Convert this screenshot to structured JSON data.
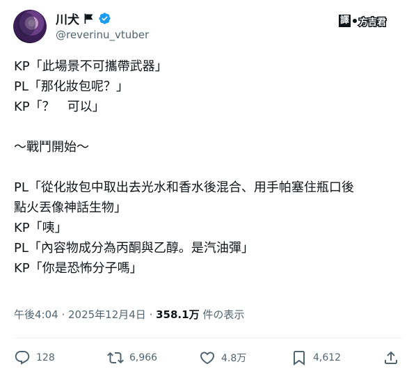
{
  "author": {
    "display_name": "川犬",
    "handle": "@reverinu_vtuber"
  },
  "watermark": {
    "prefix": "譯",
    "name": "方吉君"
  },
  "tweet": {
    "lines": [
      "KP「此場景不可攜帶武器」",
      "PL「那化妝包呢？」",
      "KP「？　可以」",
      "",
      "〜戰鬥開始〜",
      "",
      "PL「從化妝包中取出去光水和香水後混合、用手帕塞住瓶口後",
      "點火丟像神話生物」",
      "KP「咦」",
      "PL「內容物成分為丙酮與乙醇。是汽油彈」",
      "KP「你是恐怖分子嗎」"
    ]
  },
  "meta": {
    "time": "午後4:04",
    "sep1": " · ",
    "date": "2025年12月4日",
    "sep2": " · ",
    "views": "358.1万",
    "views_suffix": " 件の表示"
  },
  "actions": {
    "replies": "128",
    "reposts": "6,966",
    "likes": "4.8万",
    "bookmarks": "4,612"
  },
  "colors": {
    "text": "#0f1419",
    "secondary": "#536471",
    "verified": "#1d9bf0"
  }
}
